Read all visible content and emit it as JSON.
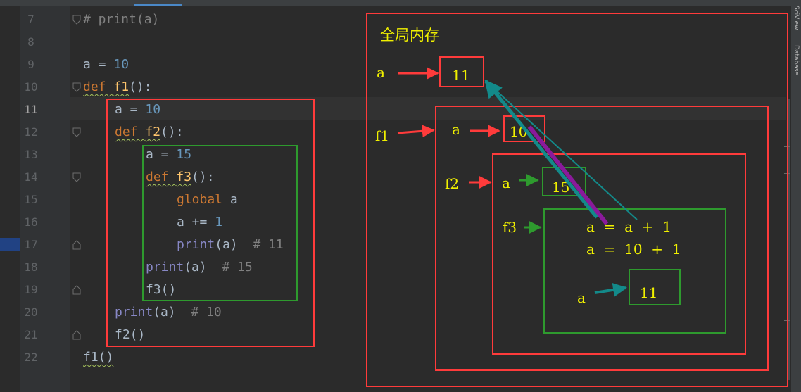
{
  "editor": {
    "lines": [
      {
        "num": "7",
        "tokens": [
          {
            "t": "# print(a)",
            "c": "cmt"
          }
        ]
      },
      {
        "num": "8",
        "tokens": []
      },
      {
        "num": "9",
        "tokens": [
          {
            "t": "a = ",
            "c": "default"
          },
          {
            "t": "10",
            "c": "num"
          }
        ]
      },
      {
        "num": "10",
        "tokens": [
          {
            "t": "def ",
            "c": "kw"
          },
          {
            "t": "f1",
            "c": "fn"
          },
          {
            "t": "():",
            "c": "default"
          }
        ]
      },
      {
        "num": "11",
        "tokens": [
          {
            "t": "a = ",
            "c": "default"
          },
          {
            "t": "10",
            "c": "num"
          }
        ]
      },
      {
        "num": "12",
        "tokens": [
          {
            "t": "def ",
            "c": "kw"
          },
          {
            "t": "f2",
            "c": "fn"
          },
          {
            "t": "():",
            "c": "default"
          }
        ]
      },
      {
        "num": "13",
        "tokens": [
          {
            "t": "a = ",
            "c": "default"
          },
          {
            "t": "15",
            "c": "num"
          }
        ]
      },
      {
        "num": "14",
        "tokens": [
          {
            "t": "def ",
            "c": "kw"
          },
          {
            "t": "f3",
            "c": "fn"
          },
          {
            "t": "():",
            "c": "default"
          }
        ]
      },
      {
        "num": "15",
        "tokens": [
          {
            "t": "global ",
            "c": "kw"
          },
          {
            "t": "a",
            "c": "default"
          }
        ]
      },
      {
        "num": "16",
        "tokens": [
          {
            "t": "a += ",
            "c": "default"
          },
          {
            "t": "1",
            "c": "num"
          }
        ]
      },
      {
        "num": "17",
        "tokens": [
          {
            "t": "print",
            "c": "builtin"
          },
          {
            "t": "(a)  ",
            "c": "default"
          },
          {
            "t": "# 11",
            "c": "cmt"
          }
        ]
      },
      {
        "num": "18",
        "tokens": [
          {
            "t": "print",
            "c": "builtin"
          },
          {
            "t": "(a)  ",
            "c": "default"
          },
          {
            "t": "# 15",
            "c": "cmt"
          }
        ]
      },
      {
        "num": "19",
        "tokens": [
          {
            "t": "f3()",
            "c": "default"
          }
        ]
      },
      {
        "num": "20",
        "tokens": [
          {
            "t": "print",
            "c": "builtin"
          },
          {
            "t": "(a)  ",
            "c": "default"
          },
          {
            "t": "# 10",
            "c": "cmt"
          }
        ]
      },
      {
        "num": "21",
        "tokens": [
          {
            "t": "f2()",
            "c": "default"
          }
        ]
      },
      {
        "num": "22",
        "tokens": [
          {
            "t": "f1()",
            "c": "default"
          }
        ]
      }
    ],
    "current_line": "11"
  },
  "sidebar": {
    "sciview_label": "SciView",
    "database_label": "Database"
  },
  "memory": {
    "title": "全局内存",
    "global": {
      "var": "a",
      "value": "11"
    },
    "f1": {
      "label": "f1",
      "var": "a",
      "value": "10"
    },
    "f2": {
      "label": "f2",
      "var": "a",
      "value": "15"
    },
    "f3": {
      "label": "f3",
      "expr1": "a  =  a  +  1",
      "expr2": "a  =  10  +  1",
      "var": "a",
      "value": "11"
    }
  },
  "colors": {
    "frame_red": "#ff3b3b",
    "frame_green": "#2e9a2e",
    "label_yellow": "#f0f000",
    "arrow_teal": "#138a8a",
    "arrow_purple": "#8a1a9b"
  }
}
